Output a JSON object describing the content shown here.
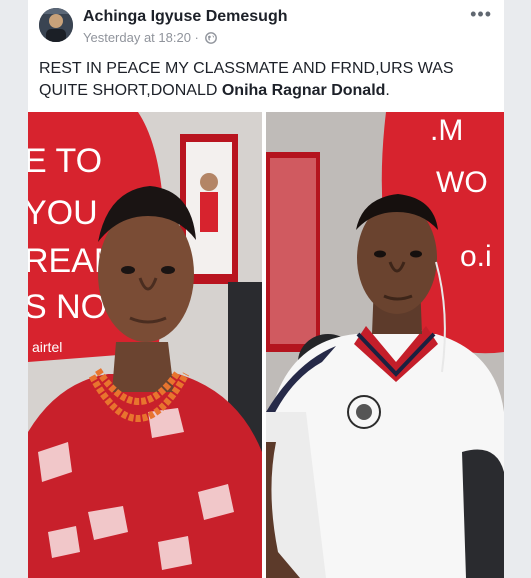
{
  "post": {
    "author_name": "Achinga Igyuse Demesugh",
    "timestamp": "Yesterday at 18:20 ·",
    "privacy_icon": "globe-icon",
    "menu_icon": "more-options-icon",
    "text_main": "REST IN PEACE MY CLASSMATE AND FRND,URS WAS QUITE SHORT,DONALD ",
    "tagged_name": "Oniha Ragnar Donald",
    "text_end": "."
  },
  "photos": {
    "left_sign_text": [
      "E TO",
      "YOU",
      "REAM",
      "S NO"
    ],
    "left_brand": "airtel",
    "right_sign_text": [
      ".M",
      "WO",
      "o.i"
    ]
  },
  "colors": {
    "name": "#1d2129",
    "meta": "#90949c",
    "airtel_red": "#d7232e"
  }
}
